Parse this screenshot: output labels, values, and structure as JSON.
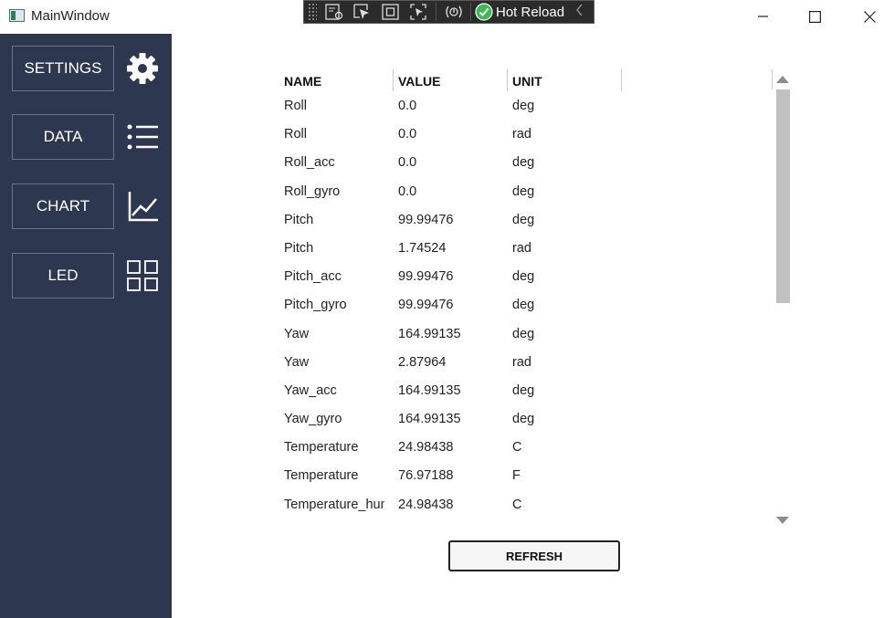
{
  "window": {
    "title": "MainWindow",
    "controls": {
      "minimize_icon": "minimize-icon",
      "maximize_icon": "maximize-icon",
      "close_icon": "close-icon"
    }
  },
  "debug_toolbar": {
    "icons": [
      "live-visual-tree-icon",
      "select-element-icon",
      "display-layout-adorners-icon",
      "track-focused-element-icon",
      "binding-failures-icon"
    ],
    "hot_reload_label": "Hot Reload",
    "hot_reload_status_color": "#3fb950"
  },
  "sidebar": {
    "background": "#2d3750",
    "items": [
      {
        "label": "SETTINGS",
        "icon": "gear-icon"
      },
      {
        "label": "DATA",
        "icon": "list-icon"
      },
      {
        "label": "CHART",
        "icon": "line-chart-icon"
      },
      {
        "label": "LED",
        "icon": "grid-icon"
      }
    ]
  },
  "table": {
    "columns": [
      "NAME",
      "VALUE",
      "UNIT"
    ],
    "rows": [
      [
        "Roll",
        "0.0",
        "deg"
      ],
      [
        "Roll",
        "0.0",
        "rad"
      ],
      [
        "Roll_acc",
        "0.0",
        "deg"
      ],
      [
        "Roll_gyro",
        "0.0",
        "deg"
      ],
      [
        "Pitch",
        "99.99476",
        "deg"
      ],
      [
        "Pitch",
        "1.74524",
        "rad"
      ],
      [
        "Pitch_acc",
        "99.99476",
        "deg"
      ],
      [
        "Pitch_gyro",
        "99.99476",
        "deg"
      ],
      [
        "Yaw",
        "164.99135",
        "deg"
      ],
      [
        "Yaw",
        "2.87964",
        "rad"
      ],
      [
        "Yaw_acc",
        "164.99135",
        "deg"
      ],
      [
        "Yaw_gyro",
        "164.99135",
        "deg"
      ],
      [
        "Temperature",
        "24.98438",
        "C"
      ],
      [
        "Temperature",
        "76.97188",
        "F"
      ],
      [
        "Temperature_hum",
        "24.98438",
        "C"
      ]
    ]
  },
  "refresh_label": "REFRESH"
}
